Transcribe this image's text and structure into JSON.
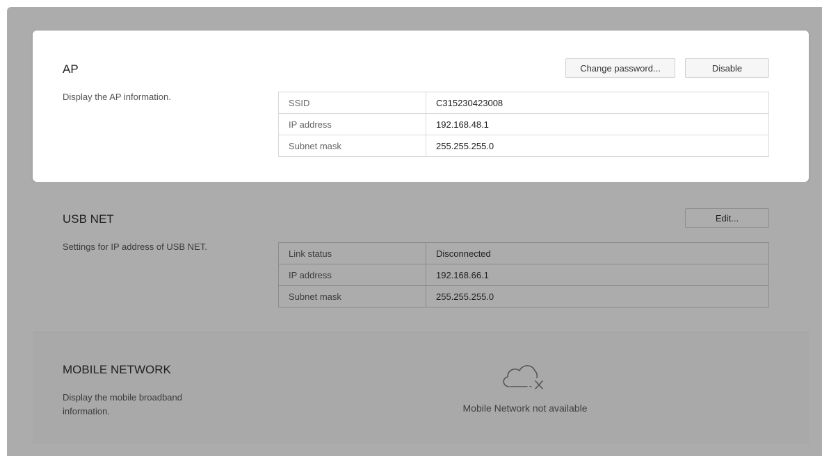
{
  "ap": {
    "title": "AP",
    "description": "Display the AP information.",
    "change_password_label": "Change password...",
    "disable_label": "Disable",
    "rows": [
      {
        "key": "SSID",
        "value": "C315230423008"
      },
      {
        "key": "IP address",
        "value": "192.168.48.1"
      },
      {
        "key": "Subnet mask",
        "value": "255.255.255.0"
      }
    ]
  },
  "usb_net": {
    "title": "USB NET",
    "description": "Settings for IP address of USB NET.",
    "edit_label": "Edit...",
    "rows": [
      {
        "key": "Link status",
        "value": "Disconnected"
      },
      {
        "key": "IP address",
        "value": "192.168.66.1"
      },
      {
        "key": "Subnet mask",
        "value": "255.255.255.0"
      }
    ]
  },
  "mobile_network": {
    "title": "MOBILE NETWORK",
    "description": "Display the mobile broadband information.",
    "status_icon": "cloud-disconnected-icon",
    "status_text": "Mobile Network not available"
  }
}
